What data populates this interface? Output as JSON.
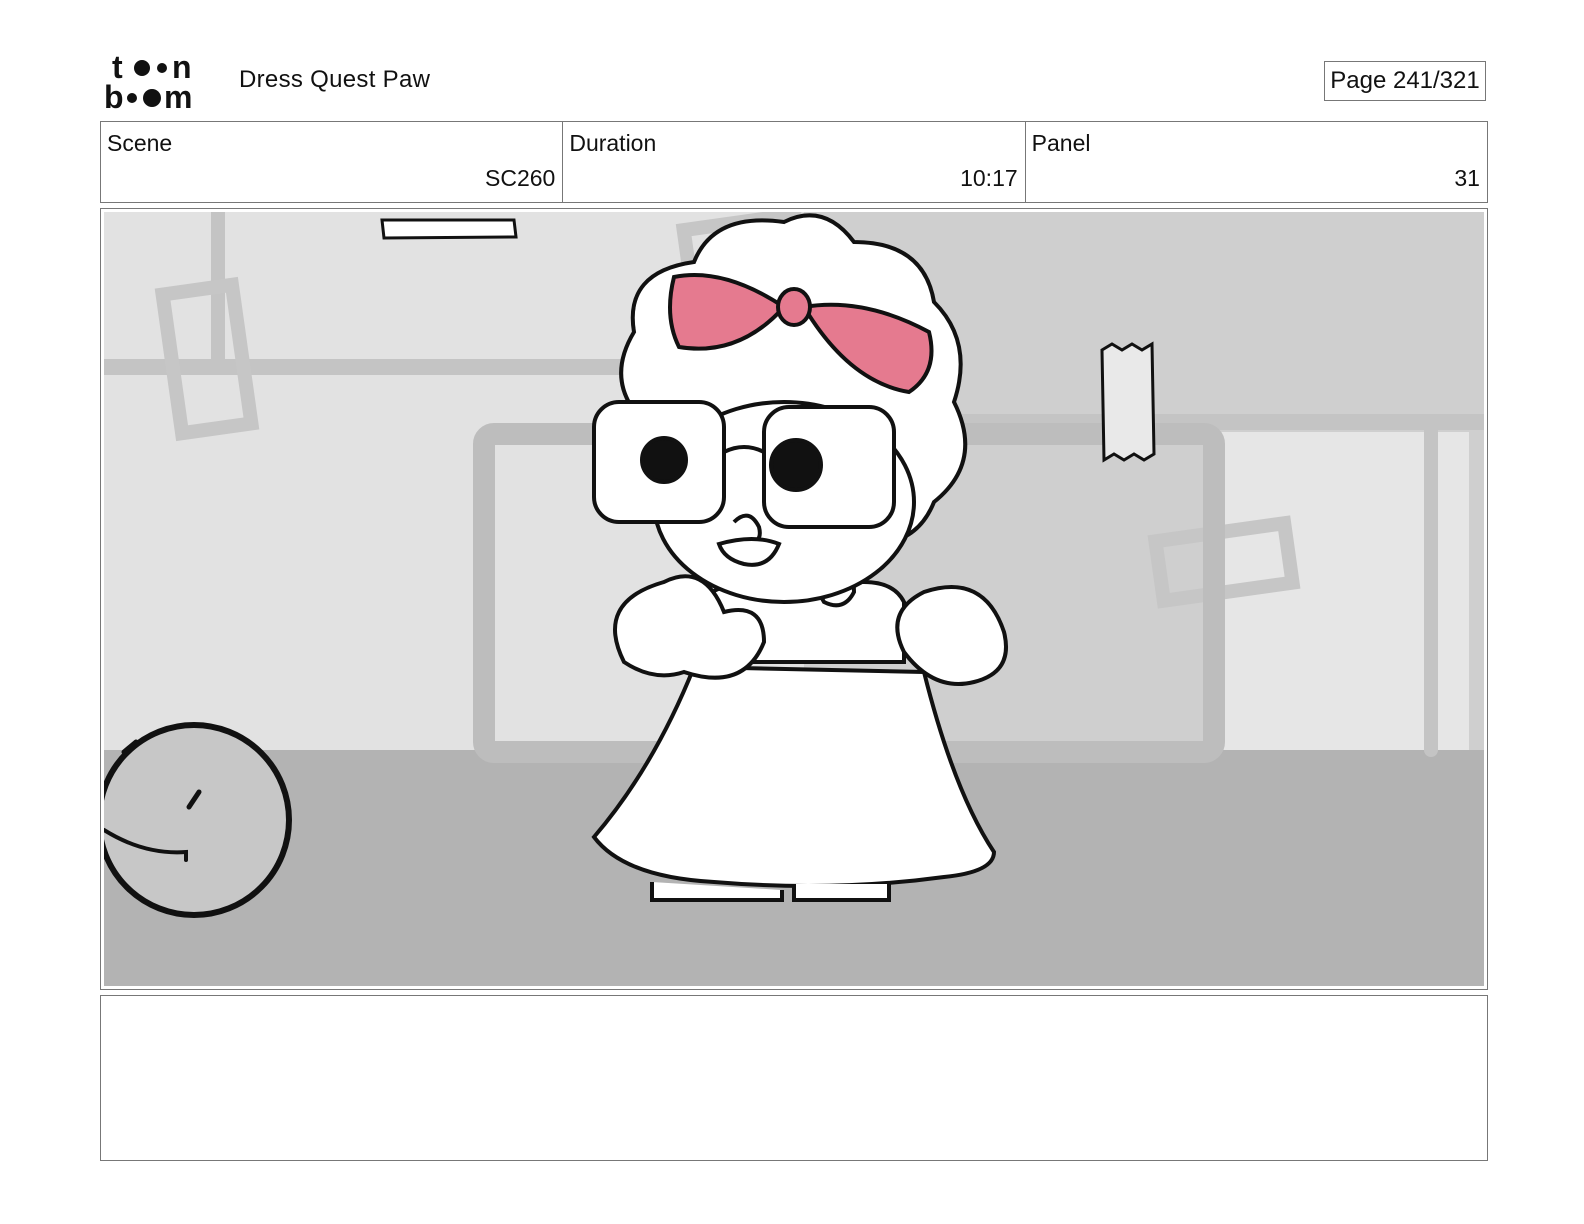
{
  "header": {
    "logo_top": "to●n",
    "logo_bottom": "b●●m",
    "project_title": "Dress Quest Paw",
    "page_indicator": "Page 241/321"
  },
  "info": {
    "scene_label": "Scene",
    "scene_value": "SC260",
    "duration_label": "Duration",
    "duration_value": "10:17",
    "panel_label": "Panel",
    "panel_value": "31"
  },
  "panel": {
    "description": "",
    "bow_color": "#e57a8f",
    "floor_color": "#b3b3b3",
    "wall_color": "#e2e2e2"
  },
  "notes": {
    "text": ""
  }
}
